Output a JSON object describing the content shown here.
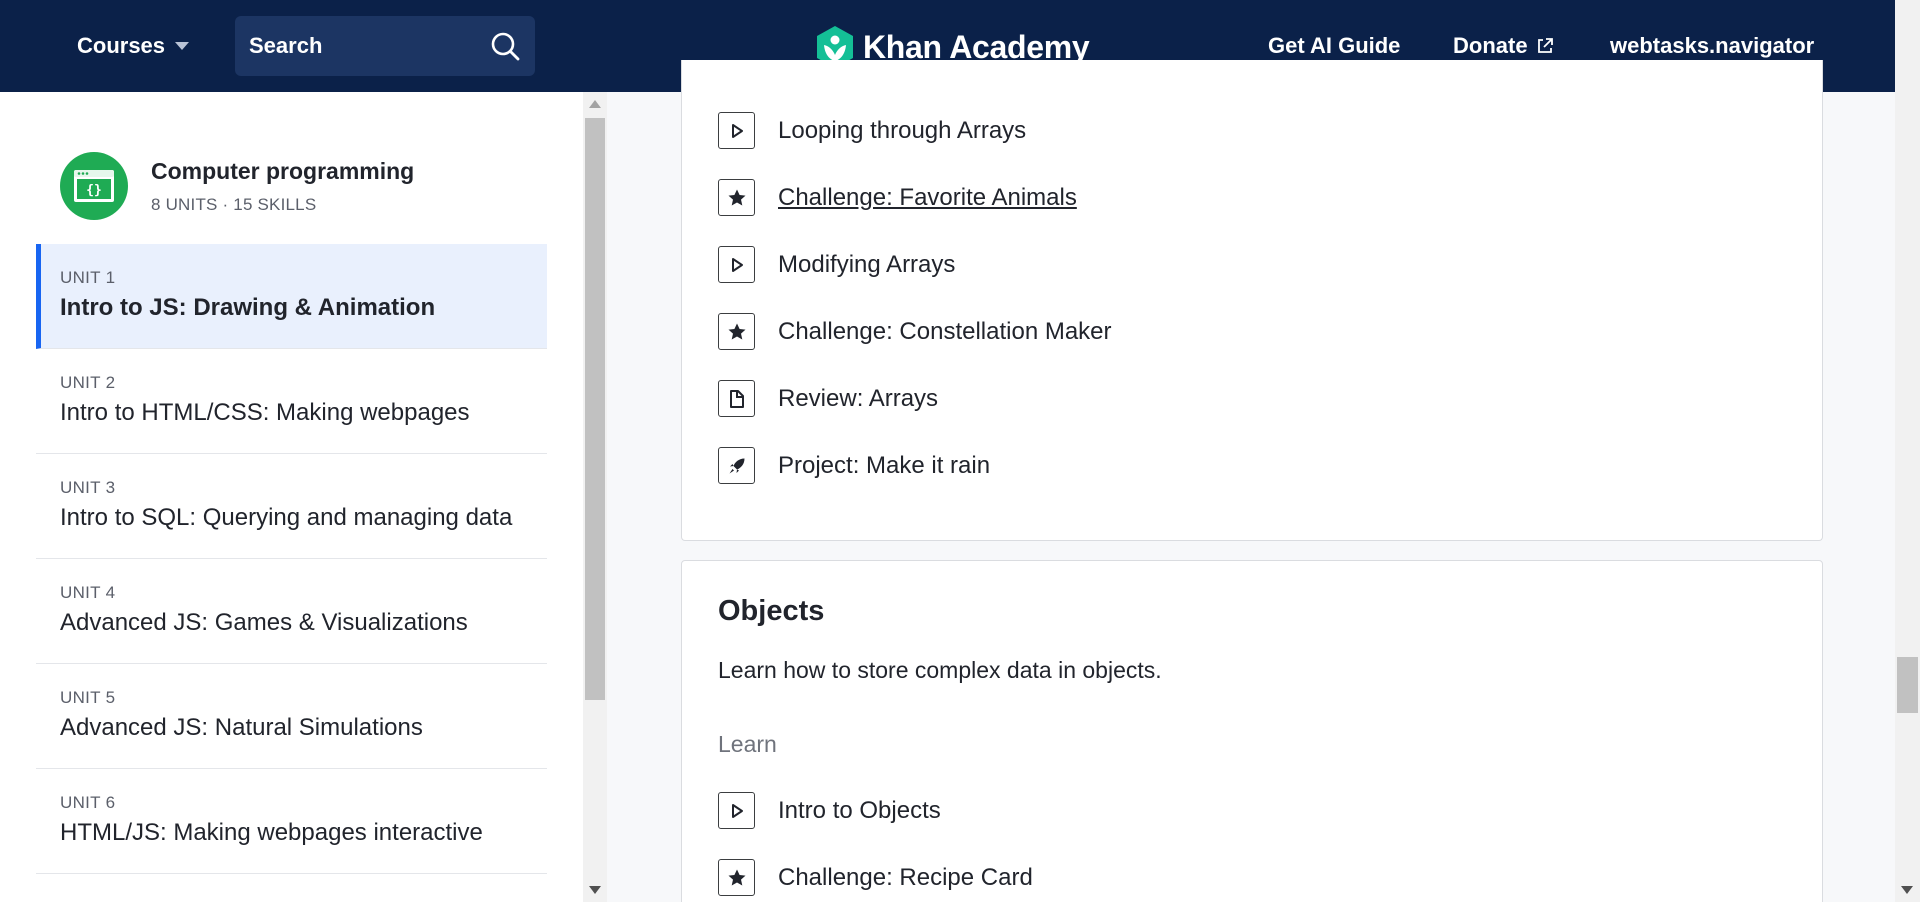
{
  "header": {
    "courses_label": "Courses",
    "search_placeholder": "Search",
    "logo_text": "Khan Academy",
    "nav": {
      "ai_guide": "Get AI Guide",
      "donate": "Donate",
      "user": "webtasks.navigator"
    }
  },
  "sidebar": {
    "course_title": "Computer programming",
    "course_meta": "8 UNITS · 15 SKILLS",
    "units": [
      {
        "label": "UNIT 1",
        "name": "Intro to JS: Drawing & Animation",
        "active": true
      },
      {
        "label": "UNIT 2",
        "name": "Intro to HTML/CSS: Making webpages",
        "active": false
      },
      {
        "label": "UNIT 3",
        "name": "Intro to SQL: Querying and managing data",
        "active": false
      },
      {
        "label": "UNIT 4",
        "name": "Advanced JS: Games & Visualizations",
        "active": false
      },
      {
        "label": "UNIT 5",
        "name": "Advanced JS: Natural Simulations",
        "active": false
      },
      {
        "label": "UNIT 6",
        "name": "HTML/JS: Making webpages interactive",
        "active": false
      }
    ]
  },
  "arrays_section": {
    "items": [
      {
        "icon": "play-icon",
        "text": "Looping through Arrays"
      },
      {
        "icon": "star-icon",
        "text": "Challenge: Favorite Animals"
      },
      {
        "icon": "play-icon",
        "text": "Modifying Arrays"
      },
      {
        "icon": "star-icon",
        "text": "Challenge: Constellation Maker"
      },
      {
        "icon": "document-icon",
        "text": "Review: Arrays"
      },
      {
        "icon": "rocket-icon",
        "text": "Project: Make it rain"
      }
    ]
  },
  "objects_section": {
    "title": "Objects",
    "description": "Learn how to store complex data in objects.",
    "learn_label": "Learn",
    "items": [
      {
        "icon": "play-icon",
        "text": "Intro to Objects"
      },
      {
        "icon": "star-icon",
        "text": "Challenge: Recipe Card"
      }
    ]
  },
  "colors": {
    "header_bg": "#0b2149",
    "active_unit_bg": "#e9f0fd",
    "active_unit_accent": "#1865f2",
    "course_icon_bg": "#1fab54",
    "logo_green": "#14bf96"
  }
}
